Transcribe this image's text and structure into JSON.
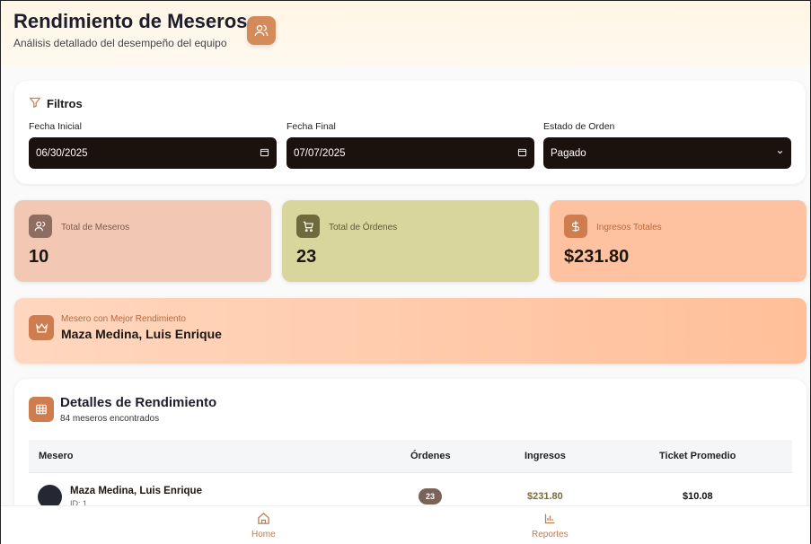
{
  "header": {
    "title": "Rendimiento de Meseros",
    "subtitle": "Análisis detallado del desempeño del equipo",
    "icon": "users-icon"
  },
  "filters": {
    "title": "Filtros",
    "fecha_inicial_label": "Fecha Inicial",
    "fecha_inicial_value": "06/30/2025",
    "fecha_final_label": "Fecha Final",
    "fecha_final_value": "07/07/2025",
    "estado_label": "Estado de Orden",
    "estado_value": "Pagado"
  },
  "stats": [
    {
      "label": "Total de Meseros",
      "value": "10",
      "icon": "users-icon",
      "bg": "#f2c7b4",
      "icon_bg": "#8f6e62",
      "label_color": "#7a5a4d"
    },
    {
      "label": "Total de Órdenes",
      "value": "23",
      "icon": "cart-icon",
      "bg": "#d9d69d",
      "icon_bg": "#6f6a3c",
      "label_color": "#5c5938"
    },
    {
      "label": "Ingresos Totales",
      "value": "$231.80",
      "icon": "dollar-icon",
      "bg": "#ffc2a0",
      "icon_bg": "#cf7d4f",
      "label_color": "#b8683a"
    }
  ],
  "best": {
    "label": "Mesero con Mejor Rendimiento",
    "name": "Maza Medina, Luis Enrique",
    "icon": "crown-icon"
  },
  "details": {
    "title": "Detalles de Rendimiento",
    "count": "84 meseros encontrados",
    "icon": "table-icon",
    "columns": [
      "Mesero",
      "Órdenes",
      "Ingresos",
      "Ticket Promedio"
    ],
    "rows": [
      {
        "name": "Maza Medina, Luis Enrique",
        "id": "ID: 1",
        "ordenes": "23",
        "ingresos": "$231.80",
        "ticket": "$10.08"
      }
    ]
  },
  "nav": [
    {
      "label": "Home",
      "icon": "home-icon"
    },
    {
      "label": "Reportes",
      "icon": "bar-chart-icon"
    }
  ]
}
